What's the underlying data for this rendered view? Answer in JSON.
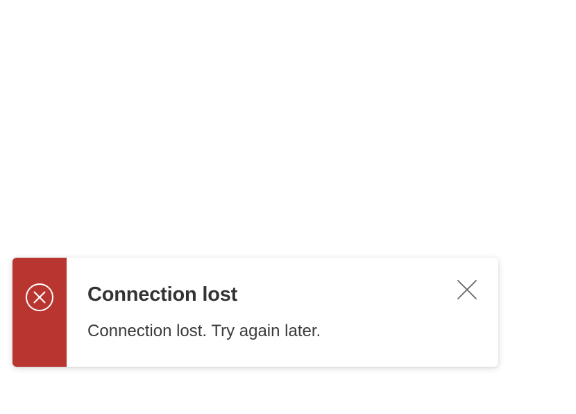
{
  "toast": {
    "type": "error",
    "title": "Connection lost",
    "message": "Connection lost. Try again later.",
    "status_icon": "error-circle-x-icon",
    "close_icon": "close-icon",
    "colors": {
      "accent": "#b83530",
      "title": "#333333",
      "message": "#3a3a3a",
      "close_icon": "#666666",
      "background": "#ffffff"
    }
  }
}
